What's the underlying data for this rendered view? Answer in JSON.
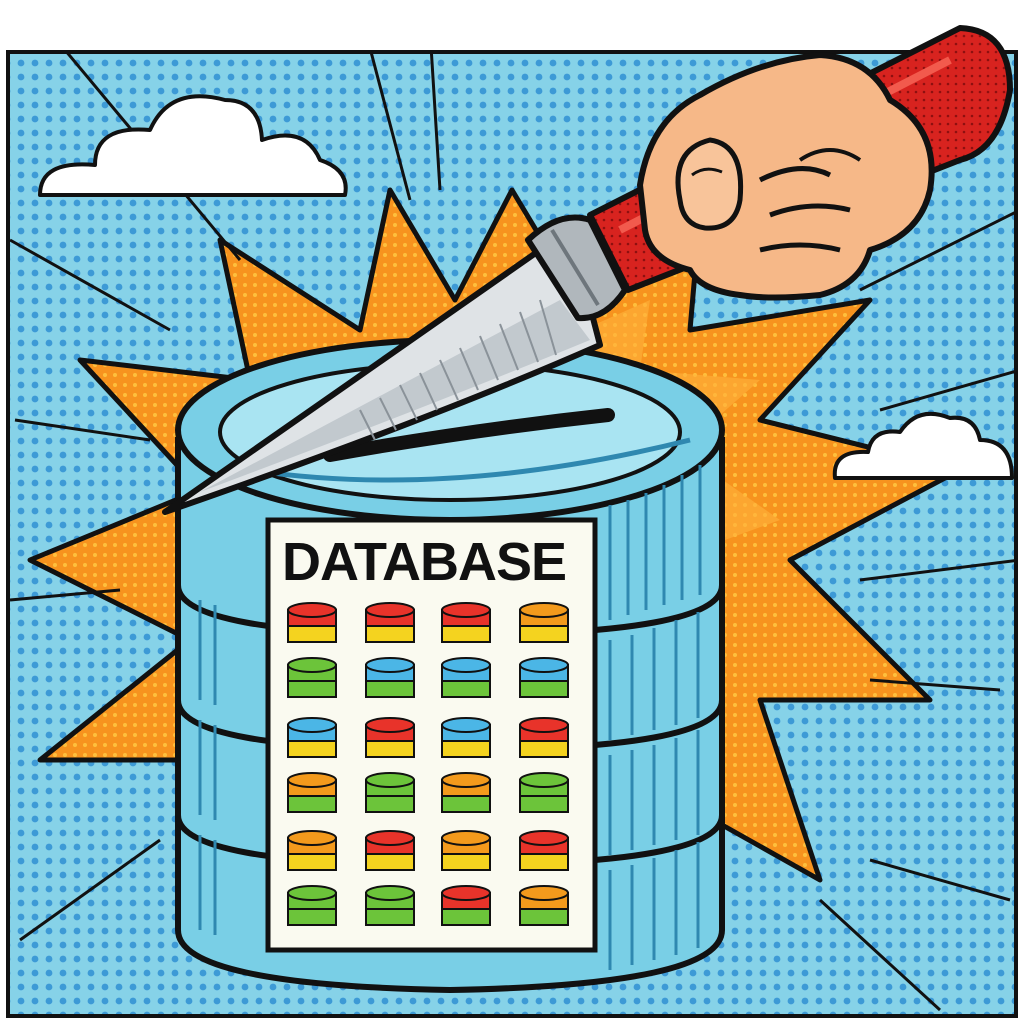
{
  "label": {
    "text": "DATABASE"
  },
  "colors": {
    "sky": "#7fd0e6",
    "sky_dot": "#3f9fd8",
    "burst": "#f7931e",
    "burst_inner": "#ffc04a",
    "cylinder": "#79cfe6",
    "cylinder_dark": "#3d9fc4",
    "label_bg": "#fafaf0",
    "blade": "#d8dde0",
    "handle": "#d8231f",
    "skin": "#f6b888",
    "outline": "#111111"
  },
  "mini_db_rows": [
    [
      "red",
      "red",
      "red",
      "orange"
    ],
    [
      "green",
      "blue",
      "blue",
      "blue"
    ],
    [
      "blue",
      "red",
      "blue",
      "red"
    ],
    [
      "orange",
      "green",
      "orange",
      "green"
    ],
    [
      "orange",
      "red",
      "orange",
      "red"
    ],
    [
      "green",
      "green",
      "red",
      "orange"
    ]
  ],
  "icons": {
    "cloud_left": "cloud-icon",
    "cloud_right": "cloud-icon",
    "knife": "knife-icon",
    "hand": "hand-icon",
    "database": "database-icon"
  }
}
